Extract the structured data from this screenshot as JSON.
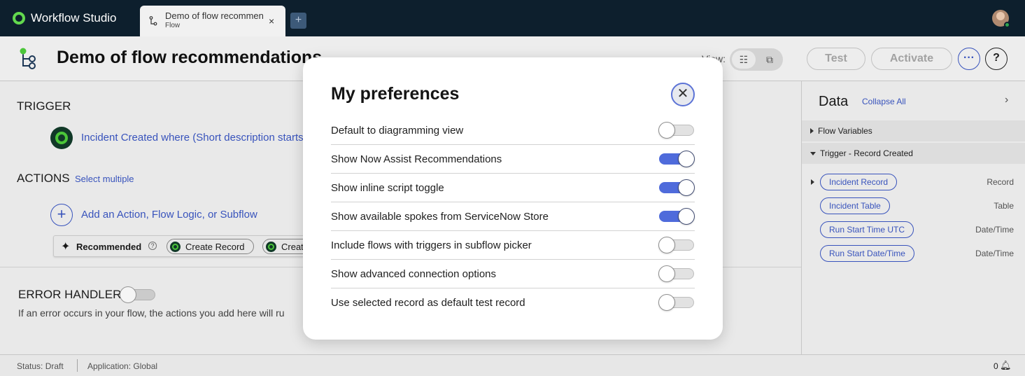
{
  "topbar": {
    "brand": "Workflow Studio",
    "tab": {
      "title": "Demo of flow recommen",
      "subtitle": "Flow",
      "close": "×"
    },
    "add_tab": "+"
  },
  "header": {
    "title": "Demo of flow recommendations",
    "view_label": "View:",
    "test_label": "Test",
    "activate_label": "Activate",
    "more_label": "···",
    "help_label": "?"
  },
  "canvas": {
    "trigger_title": "TRIGGER",
    "trigger_text": "Incident Created where (Short description starts",
    "actions_title": "ACTIONS",
    "select_multiple": "Select multiple",
    "add_action": "Add an Action, Flow Logic, or Subflow",
    "recommended_label": "Recommended",
    "recommendations": [
      "Create Record",
      "Creat"
    ],
    "error_title": "ERROR HANDLER",
    "error_text": "If an error occurs in your flow, the actions you add here will ru"
  },
  "data_panel": {
    "title": "Data",
    "collapse_all": "Collapse All",
    "groups": [
      {
        "label": "Flow Variables",
        "expanded": false
      },
      {
        "label": "Trigger - Record Created",
        "expanded": true
      }
    ],
    "items": [
      {
        "label": "Incident Record",
        "type": "Record",
        "expandable": true
      },
      {
        "label": "Incident Table",
        "type": "Table",
        "expandable": false
      },
      {
        "label": "Run Start Time UTC",
        "type": "Date/Time",
        "expandable": false
      },
      {
        "label": "Run Start Date/Time",
        "type": "Date/Time",
        "expandable": false
      }
    ]
  },
  "statusbar": {
    "status": "Status: Draft",
    "application": "Application: Global",
    "notifications": "0"
  },
  "modal": {
    "title": "My preferences",
    "preferences": [
      {
        "label": "Default to diagramming view",
        "enabled": false
      },
      {
        "label": "Show Now Assist Recommendations",
        "enabled": true
      },
      {
        "label": "Show inline script toggle",
        "enabled": true
      },
      {
        "label": "Show available spokes from ServiceNow Store",
        "enabled": true
      },
      {
        "label": "Include flows with triggers in subflow picker",
        "enabled": false
      },
      {
        "label": "Show advanced connection options",
        "enabled": false
      },
      {
        "label": "Use selected record as default test record",
        "enabled": false
      }
    ]
  },
  "colors": {
    "topbar": "#0d1f2d",
    "accent": "#4f6bdb",
    "link": "#3b57c4",
    "brand_green": "#62d84e"
  }
}
